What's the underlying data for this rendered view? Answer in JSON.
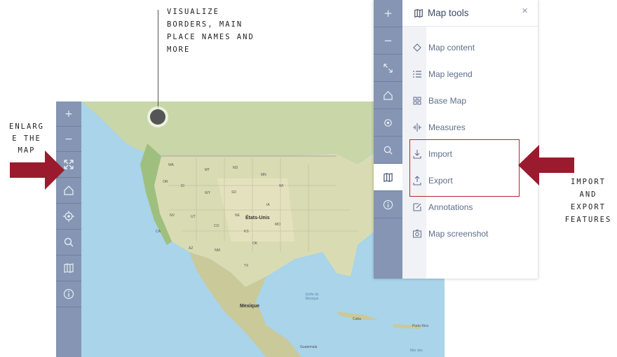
{
  "annotations": {
    "top": [
      "Visualize",
      "borders, main",
      "place names and",
      "more"
    ],
    "left": [
      "Enlarg",
      "e the",
      "map"
    ],
    "right": [
      "Import",
      "and",
      "export",
      "features"
    ]
  },
  "map_toolbar": {
    "buttons": [
      {
        "name": "zoom-in",
        "glyph": "+"
      },
      {
        "name": "zoom-out",
        "glyph": "−"
      },
      {
        "name": "fullscreen",
        "icon": "arrows-expand-icon"
      },
      {
        "name": "home",
        "icon": "home-icon"
      },
      {
        "name": "locate",
        "icon": "target-icon"
      },
      {
        "name": "search",
        "icon": "search-icon"
      },
      {
        "name": "map-tools",
        "icon": "map-icon"
      },
      {
        "name": "info",
        "icon": "info-icon"
      }
    ]
  },
  "map": {
    "labels": {
      "usa": "États-Unis",
      "mexico": "Mexique",
      "gulf": "Golfe du Mexique",
      "cuba": "Cuba",
      "puerto_rico": "Porto Rico",
      "guatemala": "Guatemala",
      "sea": "Mer des",
      "nd": "ND",
      "mn": "MN",
      "sd": "SD",
      "wi": "WI",
      "ne": "NE",
      "ia": "IA",
      "nv": "NV",
      "ut": "UT",
      "co": "CO",
      "ks": "KS",
      "az": "AZ",
      "nm": "NM",
      "tx": "TX",
      "ok": "OK",
      "mo": "MO",
      "ca": "CA",
      "or": "OR",
      "id": "ID",
      "wy": "WY",
      "mt": "MT",
      "wa": "WA"
    }
  },
  "panel": {
    "title": "Map tools",
    "close": "×",
    "items": [
      {
        "label": "Map content",
        "icon": "diamond-icon"
      },
      {
        "label": "Map legend",
        "icon": "legend-icon"
      },
      {
        "label": "Base Map",
        "icon": "grid-icon"
      },
      {
        "label": "Measures",
        "icon": "measure-icon"
      },
      {
        "label": "Import",
        "icon": "download-icon"
      },
      {
        "label": "Export",
        "icon": "upload-icon"
      },
      {
        "label": "Annotations",
        "icon": "pencil-icon"
      },
      {
        "label": "Map screenshot",
        "icon": "camera-icon"
      }
    ]
  },
  "colors": {
    "toolbar": "#8595b3",
    "accent_red": "#9b1b2e",
    "panel_text": "#5f6e8c",
    "water": "#a9d4ea",
    "land": "#d9dcb2"
  }
}
